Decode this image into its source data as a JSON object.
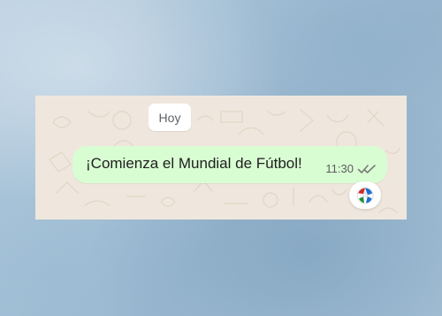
{
  "chat": {
    "date_label": "Hoy",
    "message": {
      "text": "¡Comienza el Mundial de Fútbol!",
      "time": "11:30",
      "status": "read"
    },
    "reaction": {
      "icon": "football-emoji-icon"
    }
  },
  "colors": {
    "page_background": "#a9c3d8",
    "chat_background": "#efe7dd",
    "bubble": "#d9fdd3",
    "chip": "#ffffff",
    "text": "#202020",
    "meta_text": "#5c5c5c"
  },
  "icons": {
    "read_receipt": "double-check-icon",
    "reaction": "football-emoji-icon"
  }
}
